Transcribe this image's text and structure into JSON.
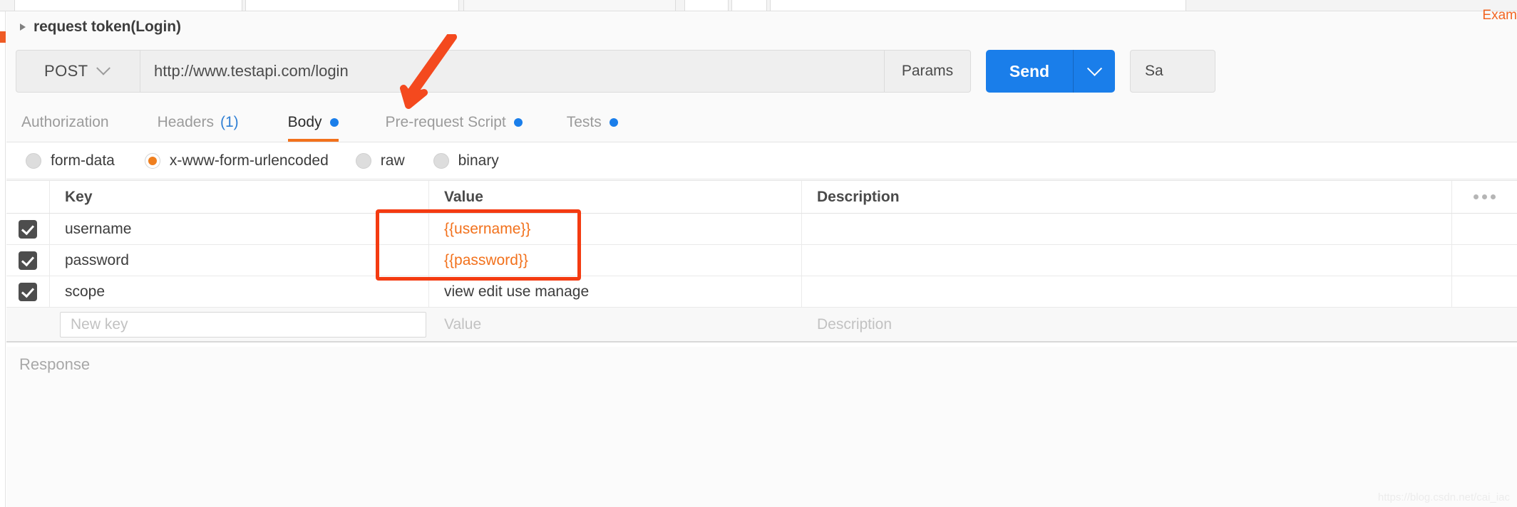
{
  "window": {
    "request_title": "request token(Login)",
    "examples_link": "Exam",
    "watermark": "https://blog.csdn.net/cai_iac"
  },
  "urlbar": {
    "method": "POST",
    "url": "http://www.testapi.com/login",
    "params_label": "Params",
    "send_label": "Send",
    "save_label": "Sa",
    "accent_blue": "#1a7eea"
  },
  "tabs": [
    {
      "label": "Authorization",
      "active": false,
      "count": "",
      "dot": false
    },
    {
      "label": "Headers",
      "active": false,
      "count": "(1)",
      "dot": false
    },
    {
      "label": "Body",
      "active": true,
      "count": "",
      "dot": true
    },
    {
      "label": "Pre-request Script",
      "active": false,
      "count": "",
      "dot": true
    },
    {
      "label": "Tests",
      "active": false,
      "count": "",
      "dot": true
    }
  ],
  "body_types": [
    {
      "label": "form-data",
      "checked": false
    },
    {
      "label": "x-www-form-urlencoded",
      "checked": true
    },
    {
      "label": "raw",
      "checked": false
    },
    {
      "label": "binary",
      "checked": false
    }
  ],
  "table": {
    "headers": {
      "key": "Key",
      "value": "Value",
      "description": "Description"
    },
    "rows": [
      {
        "checked": true,
        "key": "username",
        "value": "{{username}}",
        "description": "",
        "value_is_variable": true
      },
      {
        "checked": true,
        "key": "password",
        "value": "{{password}}",
        "description": "",
        "value_is_variable": true
      },
      {
        "checked": true,
        "key": "scope",
        "value": "view edit use manage",
        "description": "",
        "value_is_variable": false
      }
    ],
    "new_row": {
      "key_placeholder": "New key",
      "value_placeholder": "Value",
      "description_placeholder": "Description"
    }
  },
  "response": {
    "title": "Response"
  },
  "annotations": {
    "arrow_color": "#f4491e",
    "box_color": "#f43b11"
  }
}
